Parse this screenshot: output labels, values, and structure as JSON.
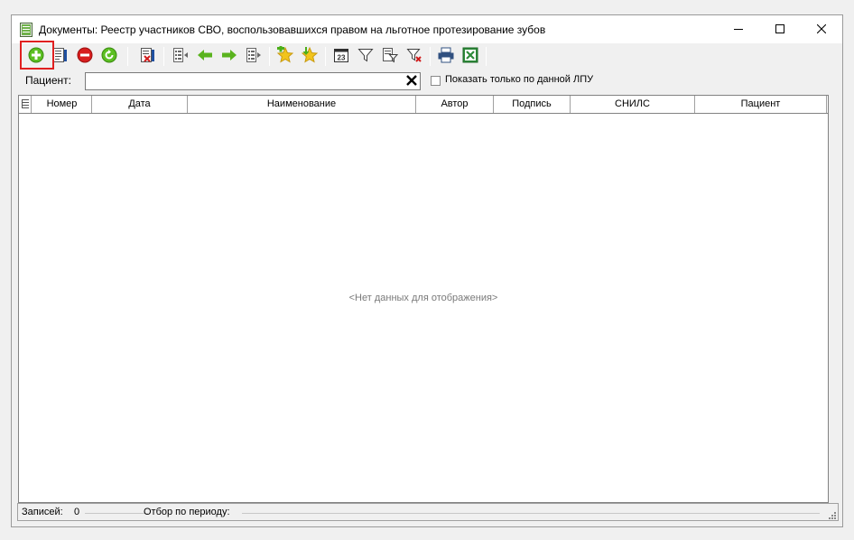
{
  "window": {
    "title": "Документы: Реестр участников СВО, воспользовавшихся правом на льготное протезирование зубов",
    "icon": "document-register-icon",
    "controls": [
      "minimize-icon",
      "maximize-icon",
      "close-icon"
    ]
  },
  "toolbar": {
    "buttons": [
      {
        "name": "add-icon",
        "color": "#4caf1a"
      },
      {
        "name": "edit-document-icon",
        "color": "#3060a0"
      },
      {
        "name": "delete-icon",
        "color": "#d01c1c"
      },
      {
        "name": "refresh-icon",
        "color": "#4caf1a"
      },
      {
        "name": "delete-list-icon",
        "color": "#c02020"
      },
      {
        "name": "columns-icon",
        "color": "#606060"
      },
      {
        "name": "arrow-left-icon",
        "color": "#5ab31e"
      },
      {
        "name": "arrow-right-icon",
        "color": "#5ab31e"
      },
      {
        "name": "columns-right-icon",
        "color": "#606060"
      },
      {
        "name": "add-favorite-icon",
        "color": "#f0c020"
      },
      {
        "name": "favorite-down-icon",
        "color": "#f0c020"
      },
      {
        "name": "calendar-icon",
        "color": "#303030"
      },
      {
        "name": "filter-icon",
        "color": "#404040"
      },
      {
        "name": "filter-edit-icon",
        "color": "#404040"
      },
      {
        "name": "filter-clear-icon",
        "color": "#c02020"
      },
      {
        "name": "print-icon",
        "color": "#305080"
      },
      {
        "name": "excel-export-icon",
        "color": "#2e8b3a"
      }
    ],
    "highlight_color": "#e02020"
  },
  "filter": {
    "patient_label": "Пациент:",
    "patient_value": "",
    "checkbox_label": "Показать только по данной ЛПУ",
    "checkbox_checked": false
  },
  "grid": {
    "columns": [
      "Номер",
      "Дата",
      "Наименование",
      "Автор",
      "Подпись",
      "СНИЛС",
      "Пациент"
    ],
    "empty_message": "<Нет данных для отображения>"
  },
  "status": {
    "records_label": "Записей:",
    "records_count": "0",
    "period_label": "Отбор по периоду:"
  }
}
